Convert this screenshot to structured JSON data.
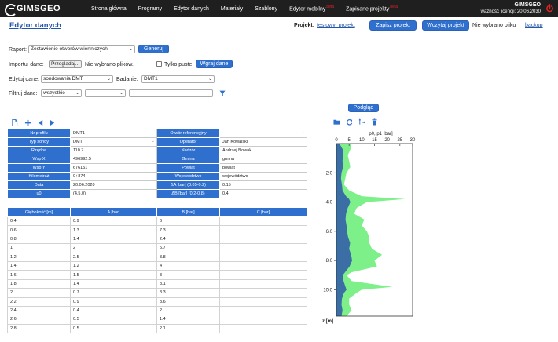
{
  "app": {
    "logo": "GIMSGEO",
    "nav": [
      {
        "label": "Strona główna",
        "beta": ""
      },
      {
        "label": "Programy",
        "beta": ""
      },
      {
        "label": "Edytor danych",
        "beta": ""
      },
      {
        "label": "Materiały",
        "beta": ""
      },
      {
        "label": "Szablony",
        "beta": ""
      },
      {
        "label": "Edytor mobilny",
        "beta": "beta"
      },
      {
        "label": "Zapisane projekty",
        "beta": "beta"
      }
    ],
    "user": {
      "name": "GIMSGEO",
      "license": "ważność licencji: 20.06.2030"
    }
  },
  "header": {
    "title": "Edytor danych",
    "project_label": "Projekt:",
    "project_name": "testowy_projekt",
    "save_button": "Zapisz projekt",
    "load_button": "Wczytaj projekt",
    "no_file": "Nie wybrano pliku",
    "backup": "backup"
  },
  "form": {
    "report_label": "Raport:",
    "report_value": "Zestawienie otworów wiertniczych",
    "generate_button": "Generuj",
    "import_label": "Importuj dane:",
    "browse_button": "Przeglądaj...",
    "no_files": "Nie wybrano plików.",
    "only_empty": "Tylko puste",
    "load_data_button": "Wgraj dane",
    "edit_label": "Edytuj dane:",
    "edit_value": "sondowania DMT",
    "test_label": "Badanie:",
    "test_value": "DMT1",
    "filter_label": "Filtruj dane:",
    "filter_value": "wszystkie",
    "preview_button": "Podgląd"
  },
  "info_rows": [
    {
      "k1": "Nr profilu",
      "v1": "DMT1",
      "k2": "Otwór referencyjny",
      "v2": ""
    },
    {
      "k1": "Typ sondy",
      "v1": "DMT",
      "k2": "Operator",
      "v2": "Jan Kowalski"
    },
    {
      "k1": "Rzędna",
      "v1": "110.7",
      "k2": "Nadzór",
      "v2": "Andrzej Nowak"
    },
    {
      "k1": "Wsp X",
      "v1": "496992.5",
      "k2": "Gmina",
      "v2": "gmina"
    },
    {
      "k1": "Wsp Y",
      "v1": "676151",
      "k2": "Powiat",
      "v2": "powiat"
    },
    {
      "k1": "Kilometraż",
      "v1": "0+874",
      "k2": "Województwo",
      "v2": "województwo"
    },
    {
      "k1": "Data",
      "v1": "20.06.2020",
      "k2": "ΔA [bar] (0.05-0.2)",
      "v2": "0.15"
    },
    {
      "k1": "u0",
      "v1": "(4.5,0)",
      "k2": "ΔB [bar] (0.2-0.8)",
      "v2": "0.4"
    }
  ],
  "data_table": {
    "headers": [
      "Głębokość [m]",
      "A [bar]",
      "B [bar]",
      "C [bar]"
    ],
    "rows": [
      [
        "0.4",
        "0.9",
        "6",
        ""
      ],
      [
        "0.6",
        "1.3",
        "7.3",
        ""
      ],
      [
        "0.8",
        "1.4",
        "2.4",
        ""
      ],
      [
        "1",
        "2",
        "5.7",
        ""
      ],
      [
        "1.2",
        "2.5",
        "3.8",
        ""
      ],
      [
        "1.4",
        "1.2",
        "4",
        ""
      ],
      [
        "1.6",
        "1.5",
        "3",
        ""
      ],
      [
        "1.8",
        "1.4",
        "3.1",
        ""
      ],
      [
        "2",
        "0.7",
        "3.3",
        ""
      ],
      [
        "2.2",
        "0.9",
        "3.6",
        ""
      ],
      [
        "2.4",
        "0.4",
        "2",
        ""
      ],
      [
        "2.6",
        "0.5",
        "1.4",
        ""
      ],
      [
        "2.8",
        "0.5",
        "2.1",
        ""
      ]
    ]
  },
  "chart_data": {
    "type": "area",
    "title": "p0, p1 [bar]",
    "xlabel": "p0, p1 [bar]",
    "ylabel": "z [m]",
    "xlim": [
      0,
      30
    ],
    "ylim": [
      0,
      11.8
    ],
    "xticks": [
      0,
      5,
      10,
      15,
      20,
      25,
      30
    ],
    "yticks": [
      2.0,
      4.0,
      6.0,
      8.0,
      10.0
    ],
    "colors": {
      "p0": "#3a6ea5",
      "p1": "#7ef08a"
    },
    "series": [
      {
        "depth": [
          0,
          0.4,
          0.8,
          1.2,
          1.6,
          2.0,
          2.4,
          2.8,
          3.2,
          3.6,
          3.8,
          4.0,
          4.4,
          4.8,
          5.2,
          5.6,
          6.0,
          6.4,
          6.8,
          7.2,
          7.6,
          8.0,
          8.4,
          8.8,
          9.0,
          9.4,
          9.8,
          10.0,
          10.2,
          10.6,
          11.0,
          11.4,
          11.8
        ],
        "values": [
          1.2,
          2.5,
          2.6,
          2.4,
          2.7,
          2.0,
          1.8,
          2.2,
          2.4,
          3.8,
          5.0,
          5.5,
          4.5,
          3.8,
          3.6,
          4.0,
          4.2,
          4.6,
          5.4,
          5.0,
          5.8,
          6.2,
          5.2,
          3.4,
          2.5,
          2.8,
          3.6,
          4.0,
          3.0,
          2.2,
          2.0,
          2.4,
          2.0
        ]
      },
      {
        "depth": [
          0,
          0.4,
          0.8,
          1.2,
          1.6,
          2.0,
          2.4,
          2.8,
          3.2,
          3.6,
          3.8,
          4.0,
          4.4,
          4.8,
          5.2,
          5.6,
          6.0,
          6.4,
          6.8,
          7.2,
          7.6,
          8.0,
          8.4,
          8.8,
          9.0,
          9.4,
          9.8,
          10.0,
          10.2,
          10.6,
          11.0,
          11.4,
          11.8
        ],
        "values": [
          6.0,
          5.5,
          4.5,
          5.0,
          5.5,
          4.0,
          3.5,
          3.0,
          5.0,
          10.0,
          27.0,
          12.0,
          8.0,
          7.0,
          11.0,
          10.0,
          12.0,
          13.0,
          13.0,
          14.0,
          18.0,
          15.0,
          16.0,
          6.0,
          4.0,
          6.0,
          22.0,
          10.0,
          8.0,
          5.0,
          5.0,
          6.0,
          4.0
        ]
      }
    ]
  }
}
